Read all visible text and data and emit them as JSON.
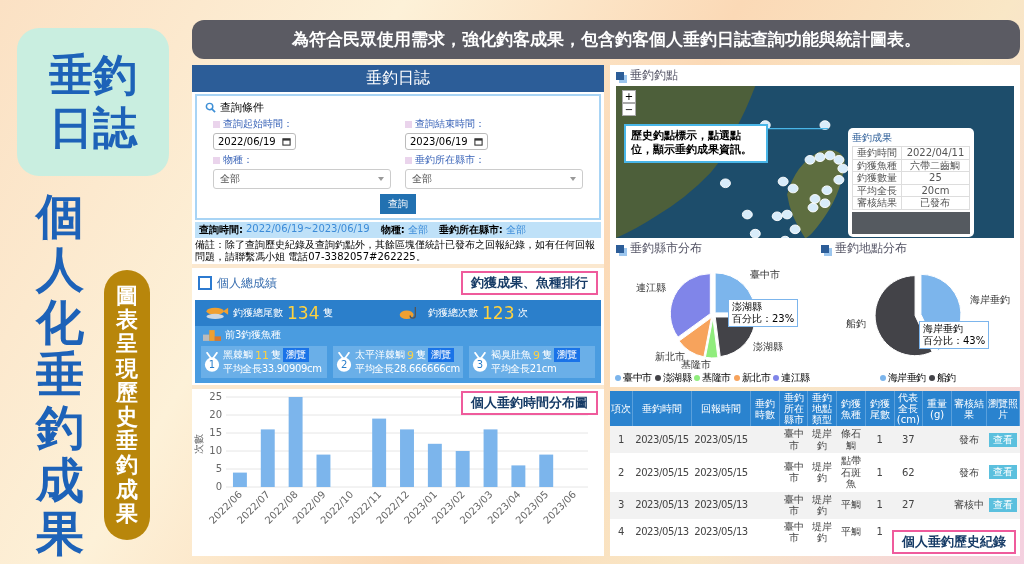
{
  "sidebar": {
    "title": "垂釣日誌",
    "headline": "個人化垂釣成果",
    "tagline": "圖表呈現歷史垂釣成果"
  },
  "banner": "為符合民眾使用需求，強化**釣客成果**，包含釣客**個人垂釣日誌**查詢功能與**統計圖表**。",
  "journal": {
    "title": "垂釣日誌",
    "heading": "查詢條件",
    "fields": [
      {
        "kind": "date",
        "label": "查詢起始時間：",
        "value": "2022/06/19"
      },
      {
        "kind": "date",
        "label": "查詢結束時間：",
        "value": "2023/06/19"
      },
      {
        "kind": "select",
        "label": "物種：",
        "value": "全部"
      },
      {
        "kind": "select",
        "label": "垂釣所在縣市：",
        "value": "全部"
      }
    ],
    "button": "查詢",
    "summary": [
      {
        "label": "查詢時間:",
        "value": "2022/06/19~2023/06/19"
      },
      {
        "label": "物種:",
        "value": "全部"
      },
      {
        "label": "垂釣所在縣市:",
        "value": "全部"
      }
    ],
    "note": "備註：除了查詢歷史紀錄及查詢釣點外，其餘區塊僅統計已發布之回報紀錄，如有任何回報問題，請聯繫馮小姐 電話07-3382057#262225。"
  },
  "stats": {
    "title": "個人總成績",
    "callout": "釣獲成果、魚種排行",
    "totals": [
      {
        "kind": "fish",
        "label": "釣獲總尾數",
        "value": "134",
        "unit": "隻"
      },
      {
        "kind": "hook",
        "label": "釣獲總次數",
        "value": "123",
        "unit": "次"
      }
    ],
    "top_heading": "前3釣獲魚種",
    "top": [
      {
        "rank": "1",
        "name": "黑棘鯛",
        "count": "11",
        "unit": "隻",
        "button": "瀏覽",
        "avg": "平均全長33.90909cm"
      },
      {
        "rank": "2",
        "name": "太平洋棘鯛",
        "count": "9",
        "unit": "隻",
        "button": "瀏覽",
        "avg": "平均全長28.666666cm"
      },
      {
        "rank": "3",
        "name": "褐臭肚魚",
        "count": "9",
        "unit": "隻",
        "button": "瀏覽",
        "avg": "平均全長21cm"
      }
    ]
  },
  "time_chart": {
    "callout": "個人垂釣時間分布圖",
    "chart_data": {
      "type": "bar",
      "ylabel": "次數",
      "categories": [
        "2022/06",
        "2022/07",
        "2022/08",
        "2022/09",
        "2022/10",
        "2022/11",
        "2022/12",
        "2023/01",
        "2023/02",
        "2023/03",
        "2023/04",
        "2023/05",
        "2023/06"
      ],
      "series": [
        {
          "color": "#7cb5ec",
          "values": [
            4,
            16,
            25,
            9,
            0,
            19,
            16,
            12,
            10,
            16,
            6,
            9,
            0
          ]
        }
      ],
      "grid": true,
      "ylim": [
        0,
        25
      ],
      "yticks": [
        0,
        5,
        10,
        15,
        20,
        25
      ]
    }
  },
  "map": {
    "title": "垂釣釣點",
    "zoom": [
      "+",
      "−"
    ],
    "callout": "**歷史釣點標示，**點選點位，顯示垂釣成果資訊。",
    "popup": {
      "title": "垂釣成果",
      "rows": [
        {
          "label": "垂釣時間",
          "value": "2022/04/11"
        },
        {
          "label": "釣獲魚種",
          "value": "六帶二齒鯛"
        },
        {
          "label": "釣獲數量",
          "value": "25"
        },
        {
          "label": "平均全長",
          "value": "20cm"
        },
        {
          "label": "審核結果",
          "value": "已發布"
        }
      ]
    }
  },
  "pies": [
    {
      "title": "垂釣縣市分布",
      "tooltip": {
        "name": "澎湖縣",
        "text": "百分比：23%"
      },
      "chart_data": {
        "type": "pie",
        "categories": [
          "臺中市",
          "澎湖縣",
          "基隆市",
          "新北市",
          "連江縣"
        ],
        "series": [
          {
            "values": [
              25,
              23,
              5,
              12,
              35
            ]
          }
        ]
      }
    },
    {
      "title": "垂釣地點分布",
      "tooltip": {
        "name": "海岸垂釣",
        "text": "百分比：43%"
      },
      "chart_data": {
        "type": "pie",
        "categories": [
          "海岸垂釣",
          "船釣"
        ],
        "series": [
          {
            "values": [
              43,
              57
            ]
          }
        ]
      }
    }
  ],
  "history": {
    "callout": "個人垂釣歷史紀錄",
    "columns": [
      "項次",
      "垂釣時間",
      "回報時間",
      "垂釣時數",
      "垂釣所在縣市",
      "垂釣地點類型",
      "釣獲魚種",
      "釣獲尾數",
      "代表全長(cm)",
      "重量(g)",
      "審核結果",
      "瀏覽照片"
    ],
    "rows": [
      {
        "cells": [
          "1",
          "2023/05/15",
          "2023/05/15",
          null,
          "臺中市",
          "堤岸釣",
          "條石鯛",
          "1",
          "37",
          null,
          "發布",
          "查看"
        ]
      },
      {
        "cells": [
          "2",
          "2023/05/15",
          "2023/05/15",
          null,
          "臺中市",
          "堤岸釣",
          "點帶石斑魚",
          "1",
          "62",
          null,
          "發布",
          "查看"
        ]
      },
      {
        "cells": [
          "3",
          "2023/05/13",
          "2023/05/13",
          null,
          "臺中市",
          "堤岸釣",
          "平鯛",
          "1",
          "27",
          null,
          "審核中",
          "查看"
        ]
      },
      {
        "cells": [
          "4",
          "2023/05/13",
          "2023/05/13",
          null,
          "臺中市",
          "堤岸釣",
          "平鯛",
          "1",
          null,
          null,
          null,
          null
        ]
      }
    ]
  }
}
